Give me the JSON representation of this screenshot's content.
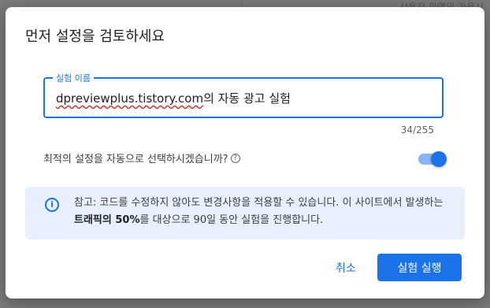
{
  "background": {
    "snippet": "사용자 화면의 가용시"
  },
  "dialog": {
    "title": "먼저 설정을 검토하세요",
    "name_field": {
      "label": "실험 이름",
      "value_domain": "dpreviewplus.tistory.com",
      "value_suffix": "의 자동 광고 실험",
      "counter": "34/255"
    },
    "optimal_setting": {
      "label": "최적의 설정을 자동으로 선택하시겠습니까?",
      "help_icon": "help-icon",
      "toggle_on": true
    },
    "note": {
      "icon": "info-icon",
      "text_before": "참고: 코드를 수정하지 않아도 변경사항을 적용할 수 있습니다. 이 사이트에서 발생하는 ",
      "text_bold": "트래픽의 50%",
      "text_after": "를 대상으로 90일 동안 실험을 진행합니다."
    },
    "buttons": {
      "cancel": "취소",
      "run": "실험 실행"
    }
  },
  "colors": {
    "accent": "#1a73e8",
    "note_bg": "#e8f0fe",
    "spell_error": "#d93025"
  }
}
